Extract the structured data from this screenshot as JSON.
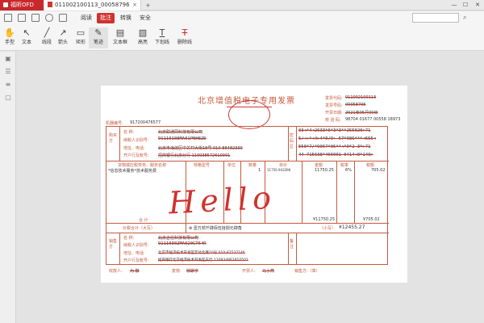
{
  "titlebar": {
    "app_name": "福昕OFD",
    "doc_tab": "011002100113_00058796",
    "tab_close": "×",
    "new_tab": "+",
    "minimize": "—",
    "maximize": "☐",
    "close": "✕"
  },
  "menu": {
    "items": [
      "阅读",
      "批注",
      "转换",
      "安全"
    ],
    "active": "批注"
  },
  "toolbar": {
    "tools": [
      {
        "label": "手型",
        "icon": "hand-icon",
        "glyph": "✋"
      },
      {
        "label": "文本",
        "icon": "cursor-icon",
        "glyph": "↖"
      },
      {
        "label": "线段",
        "icon": "line-icon",
        "glyph": "╱"
      },
      {
        "label": "箭头",
        "icon": "arrow-icon",
        "glyph": "↗"
      },
      {
        "label": "矩形",
        "icon": "rectangle-icon",
        "glyph": "▭"
      },
      {
        "label": "笔迹",
        "icon": "pen-icon",
        "glyph": "✎"
      },
      {
        "label": "文本框",
        "icon": "textbox-icon",
        "glyph": "▤"
      },
      {
        "label": "高亮",
        "icon": "highlight-icon",
        "glyph": "▧"
      },
      {
        "label": "下划线",
        "icon": "underline-icon",
        "glyph": "T"
      },
      {
        "label": "删除线",
        "icon": "strikethrough-icon",
        "glyph": "T"
      }
    ],
    "selected": "笔迹"
  },
  "invoice": {
    "title": "北京增值税电子专用发票",
    "meta": {
      "code_label": "发票代码:",
      "code_val": "011002100113",
      "number_label": "发票号码:",
      "number_val": "00058796",
      "date_label": "开票日期:",
      "date_val": "2021年05月09日",
      "check_label": "校 验 码:",
      "check_val": "98704 01677 00558 18973"
    },
    "machine_label": "机器编号:",
    "machine_no": "917200476577",
    "buyer": {
      "label": "购买方",
      "name_label": "名   称:",
      "name": "北京联通同科技有限公司",
      "tax_label": "纳税人识别号:",
      "tax": "91110108MA01PNH82D",
      "addr_label": "地址、电话:",
      "addr": "北京市海淀区中关村大街18号 010-88482339",
      "bank_label": "开户行及账号:",
      "bank": "招商银行北京分行 110938572610901"
    },
    "cipher": [
      "03<*4<2633*0*3*3**255020>71",
      "5/+>*<4>4*0/9+-67*986***<655<",
      "550*7/*9067*06**<*0*2-3*>71",
      "44-715638*466001-0414<0*149>"
    ],
    "cipher_label": "密码区",
    "headers": [
      "货物或应税劳务、服务名称",
      "规格型号",
      "单位",
      "数量",
      "单价",
      "金额",
      "税率",
      "税额"
    ],
    "item": {
      "name": "*信息技术服务*技术服务费",
      "qty": "1",
      "price": "11750.943396",
      "amount": "11750.25",
      "rate": "6%",
      "tax": "705.02"
    },
    "total_label": "合    计",
    "total_amount": "¥11750.25",
    "total_tax": "¥705.02",
    "grand_label": "价税合计（大写）",
    "grand_words": "⊗ 壹万贰仟肆佰伍拾捌元肆角",
    "grand_small_label": "（小写）",
    "grand_value": "¥12455.27",
    "seller": {
      "label": "销售方",
      "name_label": "名   称:",
      "name": "北京正信科技有限公司",
      "tax_label": "纳税人识别号:",
      "tax": "91110302MA020GT64R",
      "addr_label": "地址、电话:",
      "addr": "北京市经济技术开发区宏达北路10号 010-87532146",
      "bank_label": "开户行及账号:",
      "bank": "招商银行北京经济技术开发区支行 110934861810501"
    },
    "remark_label": "备注",
    "footer": {
      "payee_label": "收款人:",
      "payee": "为 静",
      "reviewer_label": "复核:",
      "reviewer": "徐斯宇",
      "drawer_label": "开票人:",
      "drawer": "马小燕",
      "seller_label": "销售方:（章）"
    },
    "annotation": "Hello"
  },
  "colors": {
    "accent": "#d0312d",
    "invoice_line": "#c55a3e",
    "ink": "#d0312d"
  }
}
